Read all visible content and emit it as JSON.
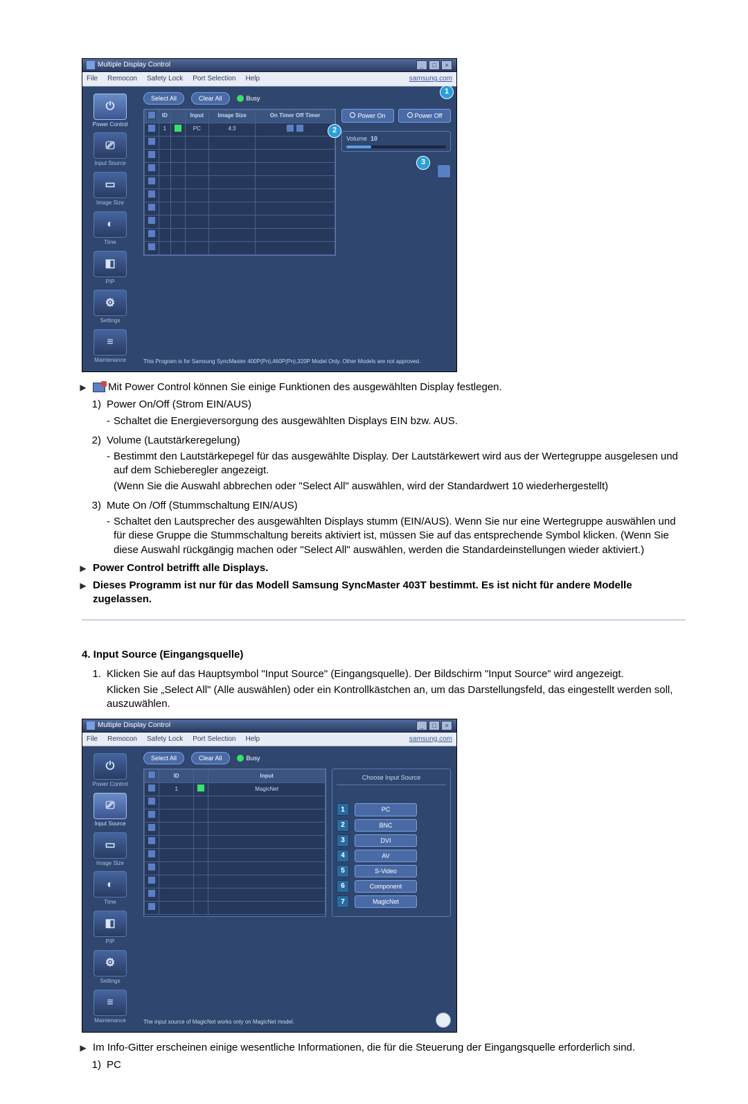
{
  "screenshot1": {
    "window_title": "Multiple Display Control",
    "menu": [
      "File",
      "Remocon",
      "Safety Lock",
      "Port Selection",
      "Help"
    ],
    "samsung_link": "samsung.com",
    "select_all": "Select All",
    "clear_all": "Clear All",
    "busy": "Busy",
    "grid_headers": [
      "",
      "ID",
      "",
      "Input",
      "Image Size",
      "On Timer Off Timer"
    ],
    "row1": [
      "",
      "1",
      "",
      "PC",
      "4:3",
      "",
      ""
    ],
    "power_on": "Power On",
    "power_off": "Power Off",
    "volume_label": "Volume",
    "volume_value": "10",
    "markers": {
      "1": "1",
      "2": "2",
      "3": "3"
    },
    "sidebar": [
      {
        "icon": "⏻",
        "label": "Power Control"
      },
      {
        "icon": "⎚",
        "label": "Input Source"
      },
      {
        "icon": "▭",
        "label": "Image Size"
      },
      {
        "icon": "◐",
        "label": "Time"
      },
      {
        "icon": "◧",
        "label": "PIP"
      },
      {
        "icon": "⚙",
        "label": "Settings"
      },
      {
        "icon": "≡",
        "label": "Maintenance"
      }
    ],
    "footer": "This Program is for Samsung SyncMaster 400P(Pn),460P(Pn),320P  Model Only. Other Models are not approved."
  },
  "text1": {
    "intro": "Mit Power Control können Sie einige Funktionen des ausgewählten Display festlegen.",
    "i1_t": "Power On/Off (Strom EIN/AUS)",
    "i1_s": "Schaltet die Energieversorgung des ausgewählten Displays EIN bzw. AUS.",
    "i2_t": "Volume (Lautstärkeregelung)",
    "i2_s1": "Bestimmt den Lautstärkepegel für das ausgewählte Display. Der Lautstärkewert wird aus der Wertegruppe ausgelesen und auf dem Schieberegler angezeigt.",
    "i2_s2": "(Wenn Sie die Auswahl abbrechen oder \"Select All\" auswählen, wird der Standardwert 10 wiederhergestellt)",
    "i3_t": "Mute On /Off (Stummschaltung EIN/AUS)",
    "i3_s": "Schaltet den Lautsprecher des ausgewählten Displays stumm (EIN/AUS). Wenn Sie nur eine Wertegruppe auswählen und für diese Gruppe die Stummschaltung bereits aktiviert ist, müssen Sie auf das entsprechende Symbol klicken. (Wenn Sie diese Auswahl rückgängig machen oder \"Select All\" auswählen, werden die Standardeinstellungen wieder aktiviert.)",
    "b1": "Power Control betrifft alle Displays.",
    "b2": "Dieses Programm ist nur für das Modell Samsung SyncMaster 403T bestimmt. Es ist nicht für andere Modelle zugelassen."
  },
  "heading2": "4. Input Source (Eingangsquelle)",
  "text2": {
    "i1_a": "Klicken Sie auf das Hauptsymbol \"Input Source\" (Eingangsquelle). Der Bildschirm \"Input Source\" wird angezeigt.",
    "i1_b": "Klicken Sie „Select All\" (Alle auswählen) oder ein Kontrollkästchen an, um das Darstellungsfeld, das eingestellt werden soll, auszuwählen."
  },
  "screenshot2": {
    "window_title": "Multiple Display Control",
    "menu": [
      "File",
      "Remocon",
      "Safety Lock",
      "Port Selection",
      "Help"
    ],
    "samsung_link": "samsung.com",
    "select_all": "Select All",
    "clear_all": "Clear All",
    "busy": "Busy",
    "grid_headers": [
      "",
      "ID",
      "",
      "Input"
    ],
    "row1": [
      "",
      "1",
      "",
      "MagicNet"
    ],
    "panel_title": "Choose Input Source",
    "sources": [
      {
        "n": "1",
        "label": "PC"
      },
      {
        "n": "2",
        "label": "BNC"
      },
      {
        "n": "3",
        "label": "DVI"
      },
      {
        "n": "4",
        "label": "AV"
      },
      {
        "n": "5",
        "label": "S-Video"
      },
      {
        "n": "6",
        "label": "Component"
      },
      {
        "n": "7",
        "label": "MagicNet"
      }
    ],
    "sidebar": [
      {
        "icon": "⏻",
        "label": "Power Control"
      },
      {
        "icon": "⎚",
        "label": "Input Source"
      },
      {
        "icon": "▭",
        "label": "Image Size"
      },
      {
        "icon": "◐",
        "label": "Time"
      },
      {
        "icon": "◧",
        "label": "PIP"
      },
      {
        "icon": "⚙",
        "label": "Settings"
      },
      {
        "icon": "≡",
        "label": "Maintenance"
      }
    ],
    "footer": "The input source of MagicNet works only on MagicNet model."
  },
  "text3": {
    "intro": "Im Info-Gitter erscheinen einige wesentliche Informationen, die für die Steuerung der Eingangsquelle erforderlich sind.",
    "i1_t": "PC"
  }
}
